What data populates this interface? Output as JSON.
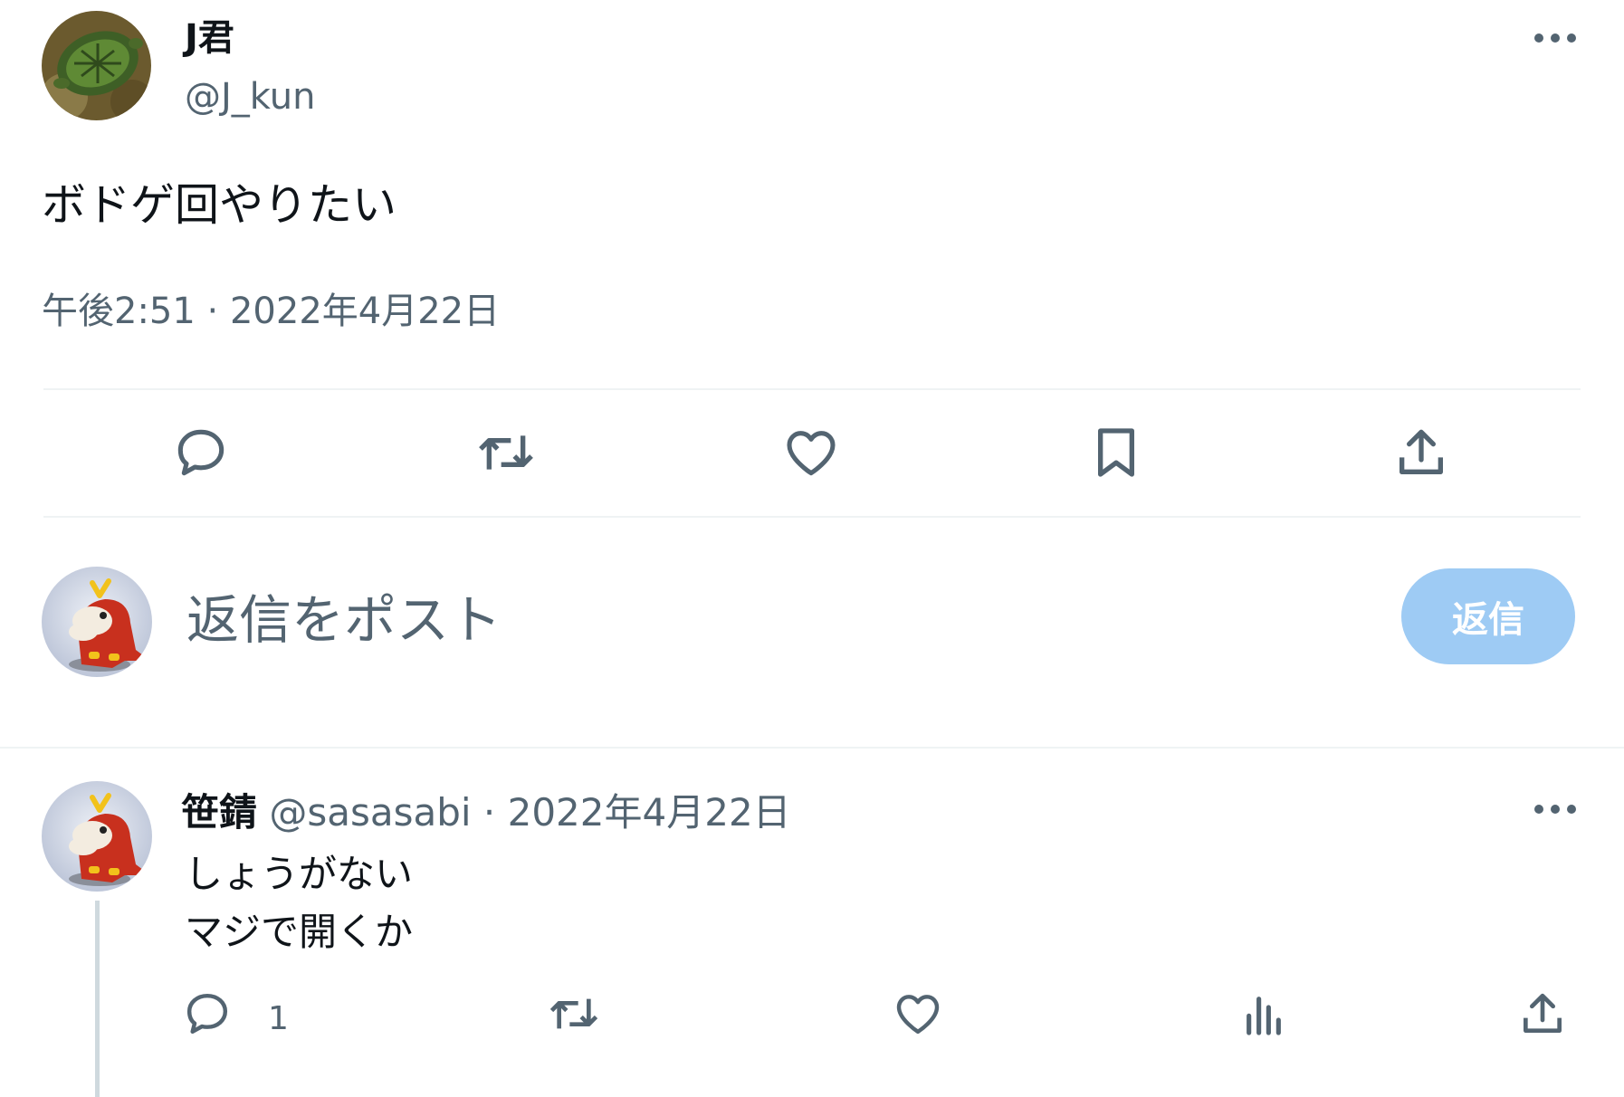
{
  "main_tweet": {
    "author_name": "J君",
    "author_handle": "@J_kun",
    "text": "ボドゲ回やりたい",
    "timestamp": "午後2:51 · 2022年4月22日",
    "actions": [
      "reply-icon",
      "repost-icon",
      "like-icon",
      "bookmark-icon",
      "share-icon"
    ]
  },
  "composer": {
    "placeholder": "返信をポスト",
    "button_label": "返信"
  },
  "reply_tweet": {
    "author_name": "笹錆",
    "author_handle": "@sasasabi",
    "date": " · 2022年4月22日",
    "text_line1": "しょうがない",
    "text_line2": "マジで開くか",
    "reply_count": "1",
    "actions": [
      "reply-icon",
      "repost-icon",
      "like-icon",
      "views-icon",
      "share-icon"
    ]
  },
  "colors": {
    "text_primary": "#0f1419",
    "text_secondary": "#536471",
    "divider": "#eff3f4",
    "reply_button_disabled": "#9ecbf4",
    "thread_line": "#cfd9de"
  }
}
